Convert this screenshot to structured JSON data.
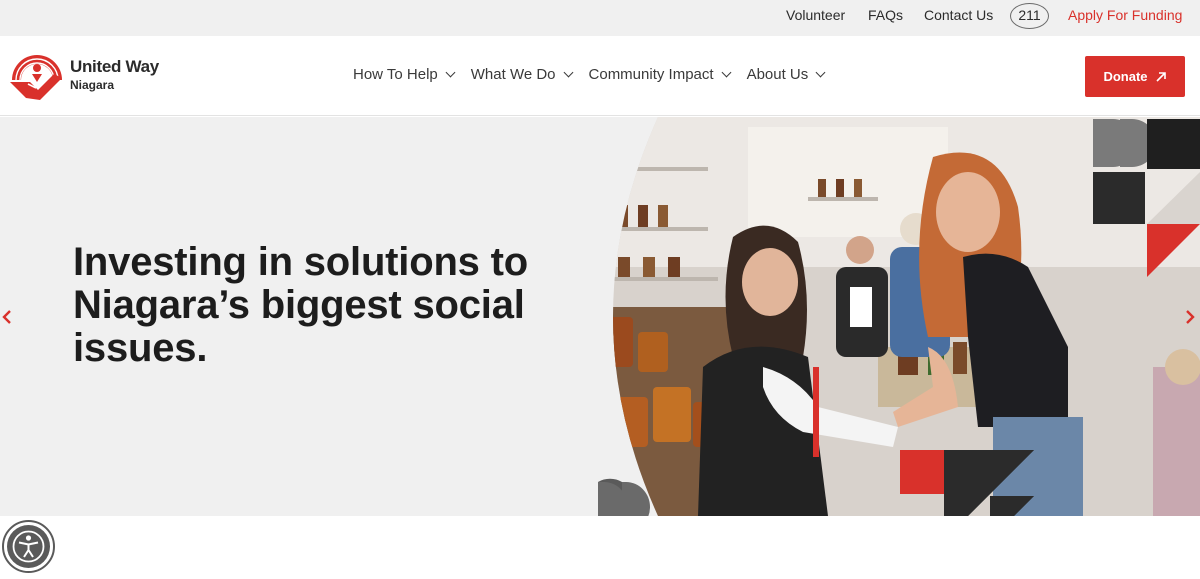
{
  "utility": {
    "volunteer": "Volunteer",
    "faqs": "FAQs",
    "contact": "Contact Us",
    "badge_211": "211",
    "apply": "Apply For Funding"
  },
  "brand": {
    "name": "United Way",
    "sub": "Niagara",
    "accent": "#d9312b"
  },
  "nav": {
    "items": [
      {
        "label": "How To Help"
      },
      {
        "label": "What We Do"
      },
      {
        "label": "Community Impact"
      },
      {
        "label": "About Us"
      }
    ]
  },
  "header": {
    "donate": "Donate"
  },
  "hero": {
    "title": "Investing in solutions to Niagara’s biggest social issues."
  },
  "icons": {
    "donate": "arrow-up-right-icon",
    "prev": "chevron-left-icon",
    "next": "chevron-right-icon",
    "accessibility": "accessibility-icon"
  }
}
